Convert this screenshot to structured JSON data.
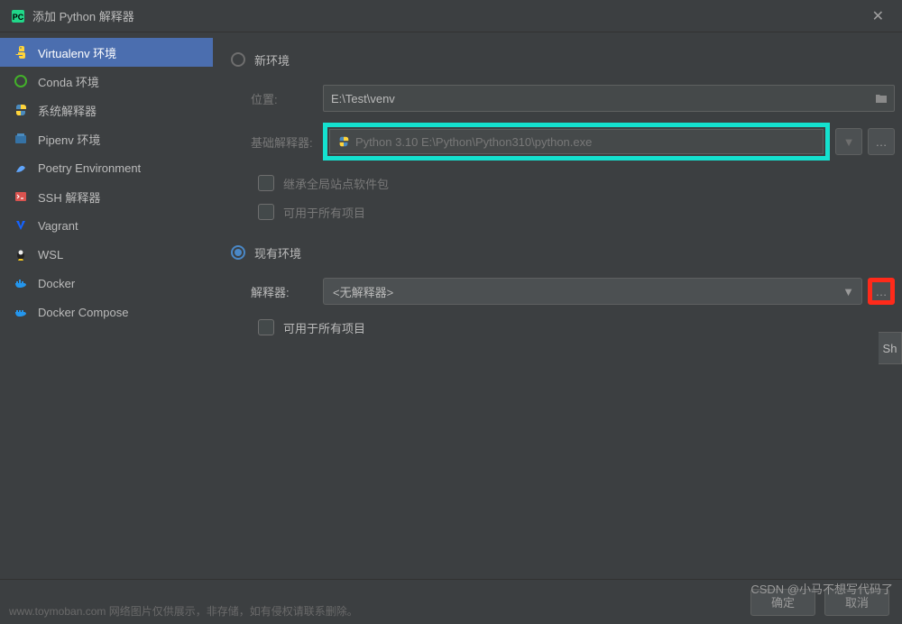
{
  "window": {
    "title": "添加 Python 解释器"
  },
  "sidebar": {
    "items": [
      {
        "label": "Virtualenv 环境"
      },
      {
        "label": "Conda 环境"
      },
      {
        "label": "系统解释器"
      },
      {
        "label": "Pipenv 环境"
      },
      {
        "label": "Poetry Environment"
      },
      {
        "label": "SSH 解释器"
      },
      {
        "label": "Vagrant"
      },
      {
        "label": "WSL"
      },
      {
        "label": "Docker"
      },
      {
        "label": "Docker Compose"
      }
    ]
  },
  "content": {
    "newEnv": {
      "radioLabel": "新环境"
    },
    "location": {
      "label": "位置:",
      "value": "E:\\Test\\venv"
    },
    "baseInterp": {
      "label": "基础解释器:",
      "value": "Python 3.10 E:\\Python\\Python310\\python.exe"
    },
    "inheritPackages": {
      "label": "继承全局站点软件包"
    },
    "availableAll1": {
      "label": "可用于所有项目"
    },
    "existingEnv": {
      "radioLabel": "现有环境"
    },
    "interpreter": {
      "label": "解释器:",
      "value": "<无解释器>"
    },
    "availableAll2": {
      "label": "可用于所有项目"
    },
    "showBtn": "Sh"
  },
  "footer": {
    "ok": "确定",
    "cancel": "取消"
  },
  "watermarks": {
    "bottom": "www.toymoban.com 网络图片仅供展示，非存储，如有侵权请联系删除。",
    "right": "CSDN @小马不想写代码了"
  }
}
